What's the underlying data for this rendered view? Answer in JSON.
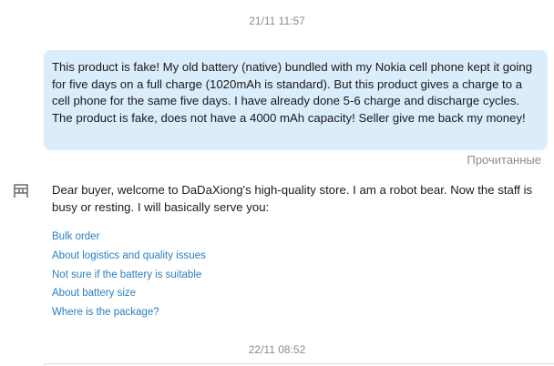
{
  "chat": {
    "timestamp_top": "21/11 11:57",
    "timestamp_bottom": "22/11 08:52",
    "buyer_message": "This product is fake! My old battery (native) bundled with my Nokia cell phone kept it going for five days on a full charge (1020mAh is standard). But this product gives a charge to a cell phone for the same five days. I have already done 5-6 charge and discharge cycles. The product is fake, does not have a 4000 mAh capacity! Seller give me back my money!",
    "read_status": "Прочитанные",
    "bot_message": "Dear buyer, welcome to DaDaXiong's high-quality store. I am a robot bear. Now the staff is busy or resting. I will basically serve you:",
    "options": [
      "Bulk order",
      "About logistics and quality issues",
      "Not sure if the battery is suitable",
      "About battery size",
      "Where is the package?"
    ]
  },
  "colors": {
    "bubble_bg": "#dbecfb",
    "link": "#2a7fc0",
    "muted": "#8c8c8c"
  },
  "icons": {
    "bot_avatar": "store-icon"
  }
}
